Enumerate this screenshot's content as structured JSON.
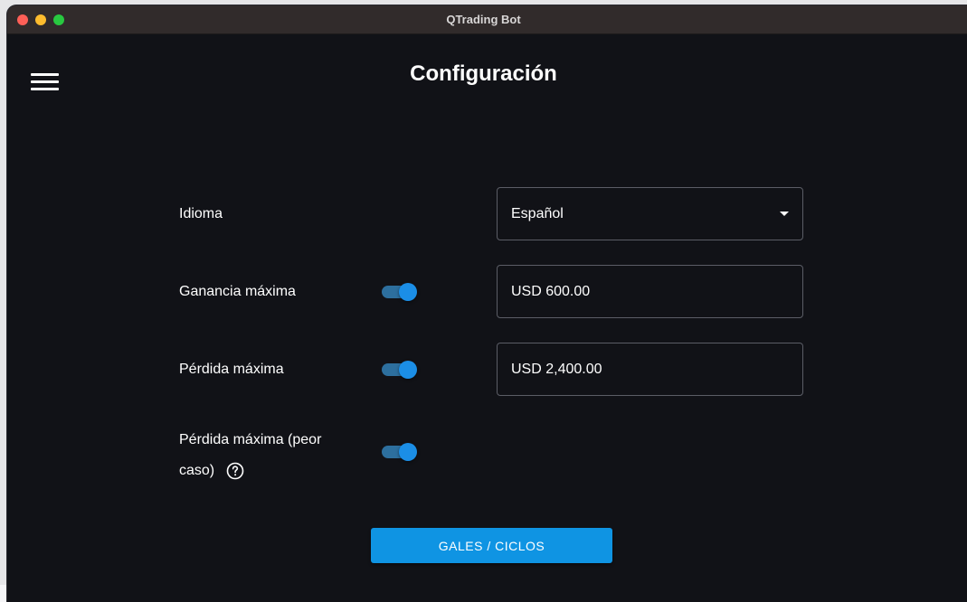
{
  "window": {
    "title": "QTrading Bot"
  },
  "header": {
    "title": "Configuración",
    "menu_icon": "hamburger-menu-icon"
  },
  "settings": {
    "language": {
      "label": "Idioma",
      "selected": "Español"
    },
    "max_profit": {
      "label": "Ganancia máxima",
      "enabled": true,
      "value": "USD 600.00"
    },
    "max_loss": {
      "label": "Pérdida máxima",
      "enabled": true,
      "value": "USD 2,400.00"
    },
    "max_loss_worst": {
      "label_line1": "Pérdida máxima (peor",
      "label_line2": "caso)",
      "enabled": true,
      "help_icon": "help-circle-icon"
    }
  },
  "actions": {
    "gales_button": "GALES / CICLOS"
  },
  "colors": {
    "background": "#111217",
    "titlebar": "#312b2b",
    "accent": "#0f94e3",
    "toggle_track": "#2d6f9e",
    "field_border": "#5b5d66"
  }
}
